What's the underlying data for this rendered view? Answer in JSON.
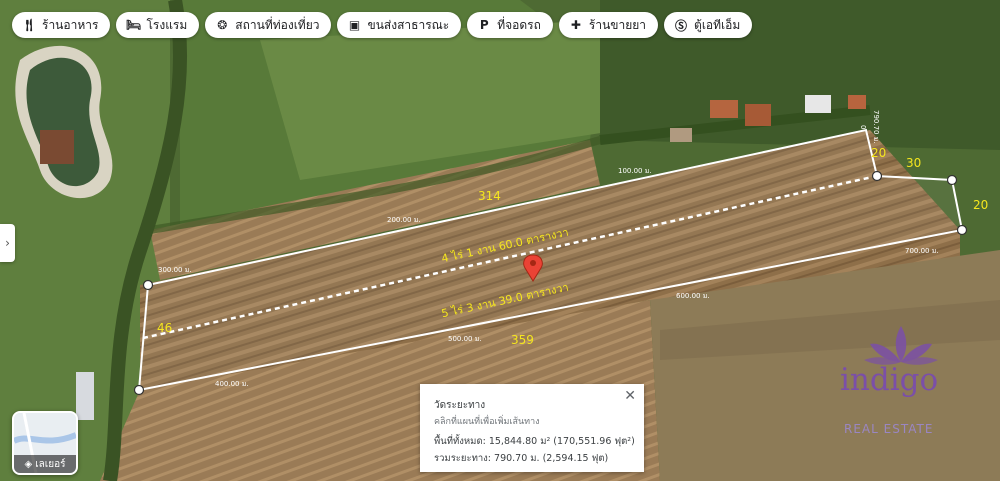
{
  "chips": [
    {
      "icon": "restaurant-icon",
      "label": "ร้านอาหาร"
    },
    {
      "icon": "hotel-icon",
      "label": "โรงแรม"
    },
    {
      "icon": "attraction-icon",
      "label": "สถานที่ท่องเที่ยว"
    },
    {
      "icon": "transit-icon",
      "label": "ขนส่งสาธารณะ"
    },
    {
      "icon": "parking-icon",
      "label": "ที่จอดรถ"
    },
    {
      "icon": "pharmacy-icon",
      "label": "ร้านขายยา"
    },
    {
      "icon": "atm-icon",
      "label": "ตู้เอทีเอ็ม"
    }
  ],
  "layers": {
    "label": "เลเยอร์"
  },
  "measure": {
    "title": "วัดระยะทาง",
    "hint": "คลิกที่แผนที่เพื่อเพิ่มเส้นทาง",
    "area": "พื้นที่ทั้งหมด: 15,844.80 ม² (170,551.96 ฟุต²)",
    "distance": "รวมระยะทาง: 790.70 ม. (2,594.15 ฟุต)"
  },
  "path_labels": {
    "scale": [
      "0",
      "100.00 ม.",
      "200.00 ม.",
      "300.00 ม.",
      "400.00 ม.",
      "500.00 ม.",
      "600.00 ม.",
      "700.00 ม.",
      "790.70 ม."
    ]
  },
  "plot_labels": {
    "upper_area": "4 ไร่ 1 งาน 60.0 ตารางวา",
    "lower_area": "5 ไร่ 3 งาน 39.0 ตารางวา",
    "side_314": "314",
    "side_359": "359",
    "side_46": "46",
    "side_20a": "20",
    "side_30": "30",
    "side_20b": "20"
  },
  "logo": {
    "word": "indigo",
    "subtitle": "REAL ESTATE"
  },
  "colors": {
    "label_yellow": "#f5e61e",
    "logo_purple": "#7b4fa8",
    "pin_red": "#ea4335"
  }
}
